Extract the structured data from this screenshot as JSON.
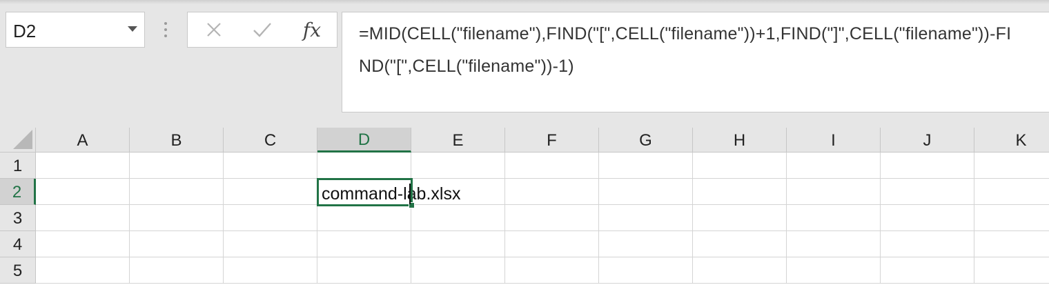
{
  "name_box": {
    "value": "D2"
  },
  "formula_bar": {
    "cancel_icon": "close-icon",
    "enter_icon": "check-icon",
    "fx_label": "fx",
    "formula": "=MID(CELL(\"filename\"),FIND(\"[\",CELL(\"filename\"))+1,FIND(\"]\",CELL(\"filename\"))-FIND(\"[\",CELL(\"filename\"))-1)"
  },
  "grid": {
    "columns": [
      "A",
      "B",
      "C",
      "D",
      "E",
      "F",
      "G",
      "H",
      "I",
      "J",
      "K"
    ],
    "rows": [
      "1",
      "2",
      "3",
      "4",
      "5"
    ],
    "active_column": "D",
    "active_row": "2",
    "cells": {
      "D2": "command-lab.xlsx"
    }
  },
  "colors": {
    "accent": "#217346",
    "header_bg": "#e6e6e6",
    "header_active_bg": "#d2d2d2",
    "gridline": "#d4d4d4"
  }
}
